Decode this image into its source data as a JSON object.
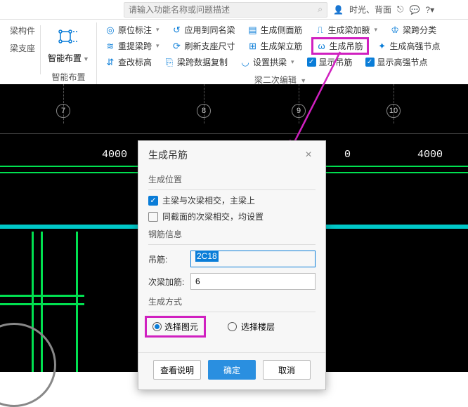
{
  "topbar": {
    "search_placeholder": "请输入功能名称或问题描述",
    "user_text": "时光、背面"
  },
  "ribbon": {
    "left1": "梁构件",
    "left2": "梁支座",
    "smart_label": "智能布置",
    "smart_footer": "智能布置",
    "row1": {
      "b1": "原位标注",
      "b2": "应用到同名梁",
      "b3": "生成侧面筋",
      "b4": "生成梁加腋",
      "b5": "梁跨分类"
    },
    "row2": {
      "b1": "重提梁跨",
      "b2": "刷新支座尺寸",
      "b3": "生成架立筋",
      "b4": "生成吊筋",
      "b5": "生成高强节点"
    },
    "row3": {
      "b1": "查改标高",
      "b2": "梁跨数据复制",
      "b3": "设置拱梁",
      "b4": "显示吊筋",
      "b5": "显示高强节点"
    },
    "sec_footer": "梁二次编辑"
  },
  "canvas": {
    "ticks": [
      "7",
      "8",
      "9",
      "10"
    ],
    "dim1": "4000",
    "dim2": "0",
    "dim3": "4000"
  },
  "dialog": {
    "title": "生成吊筋",
    "grp_pos": "生成位置",
    "chk1": "主梁与次梁相交，主梁上",
    "chk2": "同截面的次梁相交，均设置",
    "grp_info": "钢筋信息",
    "f_hanger": "吊筋:",
    "v_hanger": "2C18",
    "f_sub": "次梁加筋:",
    "v_sub": "6",
    "grp_mode": "生成方式",
    "r1": "选择图元",
    "r2": "选择楼层",
    "btn_help": "查看说明",
    "btn_ok": "确定",
    "btn_cancel": "取消"
  }
}
